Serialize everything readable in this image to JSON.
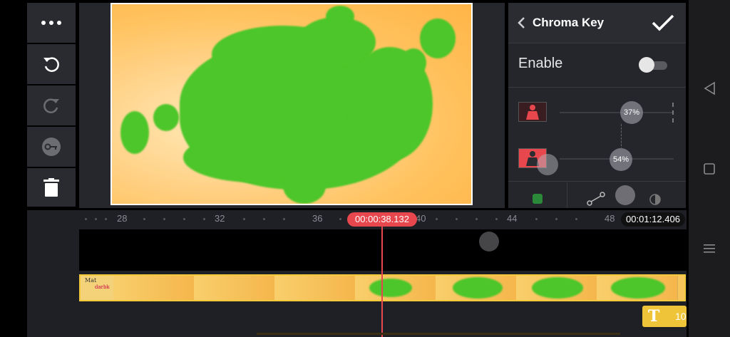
{
  "toolbar": {
    "more_icon": "more-horizontal-icon",
    "undo_icon": "undo-icon",
    "redo_icon": "redo-icon",
    "keyframe_icon": "keyframe-icon",
    "delete_icon": "trash-icon",
    "split_icon": "split-icon",
    "pin_icon": "pin-icon"
  },
  "panel": {
    "title": "Chroma Key",
    "enable_label": "Enable",
    "enable_on": false,
    "slider1_value": "37%",
    "slider2_value": "54%"
  },
  "timeline": {
    "ruler_ticks": [
      "28",
      "32",
      "36",
      "40",
      "44",
      "48"
    ],
    "current_time": "00:00:38.132",
    "duration": "00:01:12.406",
    "text_layer_label": "10",
    "clip_thumb_text_1": "Mat",
    "clip_thumb_text_2": "darbk"
  },
  "colors": {
    "accent_red": "#e8474e",
    "clip_border": "#f2c93a",
    "chroma_green": "#4cc62a"
  }
}
